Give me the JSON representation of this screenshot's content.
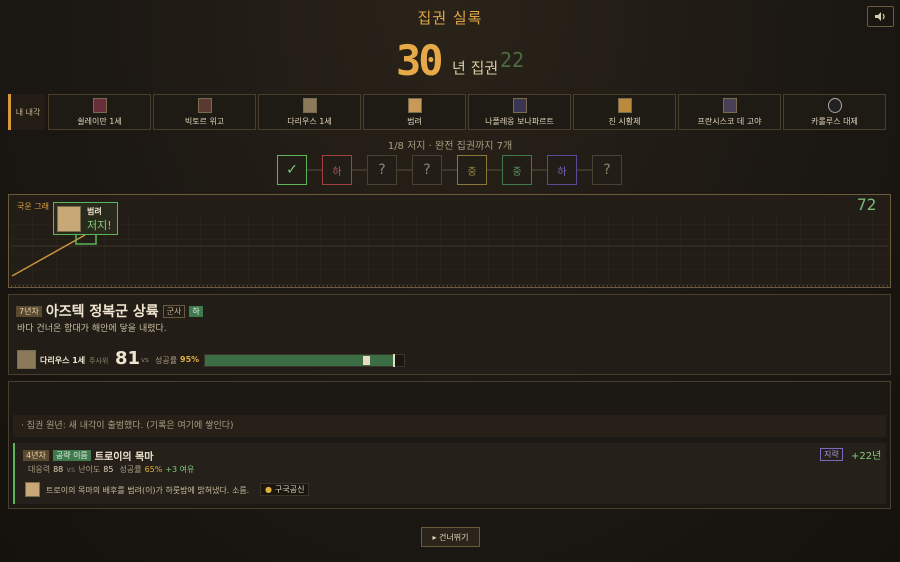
{
  "header": {
    "title": "집권 실록",
    "years": "30",
    "years_unit": "년 집권",
    "ghost_value": "22"
  },
  "roster": {
    "label": "내 내각",
    "members": [
      {
        "name": "쉴레이만 1세",
        "color": "#6a2d3a"
      },
      {
        "name": "빅토르 위고",
        "color": "#5a3a30"
      },
      {
        "name": "다리우스 1세",
        "color": "#8a7a5a"
      },
      {
        "name": "범려",
        "color": "#c79a5a"
      },
      {
        "name": "나폴레옹 보나파르트",
        "color": "#3a3550"
      },
      {
        "name": "진 시황제",
        "color": "#b98a3a"
      },
      {
        "name": "프란시스코 데 고야",
        "color": "#4a4055"
      },
      {
        "name": "카롤루스 대제",
        "color": "#222222"
      }
    ]
  },
  "progress": {
    "text": "1/8 저지 · 완전 집권까지 7개",
    "nodes": [
      {
        "label": "✓",
        "border": "#5db55a",
        "color": "#7fcf7a"
      },
      {
        "label": "하",
        "border": "#a24040",
        "color": "#b25a5a"
      },
      {
        "label": "?",
        "border": "#4a4133",
        "color": "#8d826c"
      },
      {
        "label": "?",
        "border": "#4a4133",
        "color": "#8d826c"
      },
      {
        "label": "중",
        "border": "#8d7838",
        "color": "#a08a45"
      },
      {
        "label": "중",
        "border": "#3f7a4e",
        "color": "#5a9a6a"
      },
      {
        "label": "하",
        "border": "#5a4a9a",
        "color": "#7a6ac0"
      },
      {
        "label": "?",
        "border": "#4a4133",
        "color": "#8d826c"
      }
    ]
  },
  "chart": {
    "label": "국운 그래",
    "value": "72",
    "popup_name": "범려",
    "popup_status": "저지!"
  },
  "event": {
    "turn": "7년차",
    "title": "아즈텍 정복군 상륙",
    "category": "군사",
    "difficulty": "하",
    "description": "바다 건너온 함대가 해안에 닿을 내렸다.",
    "defender": "다리우스 1세",
    "dice_label": "주사위",
    "dice_value": "81",
    "vs": "vs",
    "rate_label": "성공률",
    "rate_value": "95%",
    "rate_fraction": 0.95
  },
  "log": {
    "info": "· 집권 원년: 새 내각이 출범했다. (기록은 여기에 쌓인다)",
    "entry": {
      "turn": "4년차",
      "badge": "공략 이름",
      "title": "트로이의 목마",
      "stat1_label": "대응력",
      "stat1_value": "88",
      "vs": "vs",
      "stat2_label": "난이도",
      "stat2_value": "85",
      "rate_label": "성공률",
      "rate_value": "65%",
      "margin": "+3 여유",
      "tag": "지략",
      "years": "+22년",
      "desc": "트로이의 목마의 배후를 범려(이)가 하룻밤에 밝혀냈다. 소름.",
      "reward": "구국공신"
    }
  },
  "controls": {
    "skip": "▸ 건너뛰기"
  }
}
